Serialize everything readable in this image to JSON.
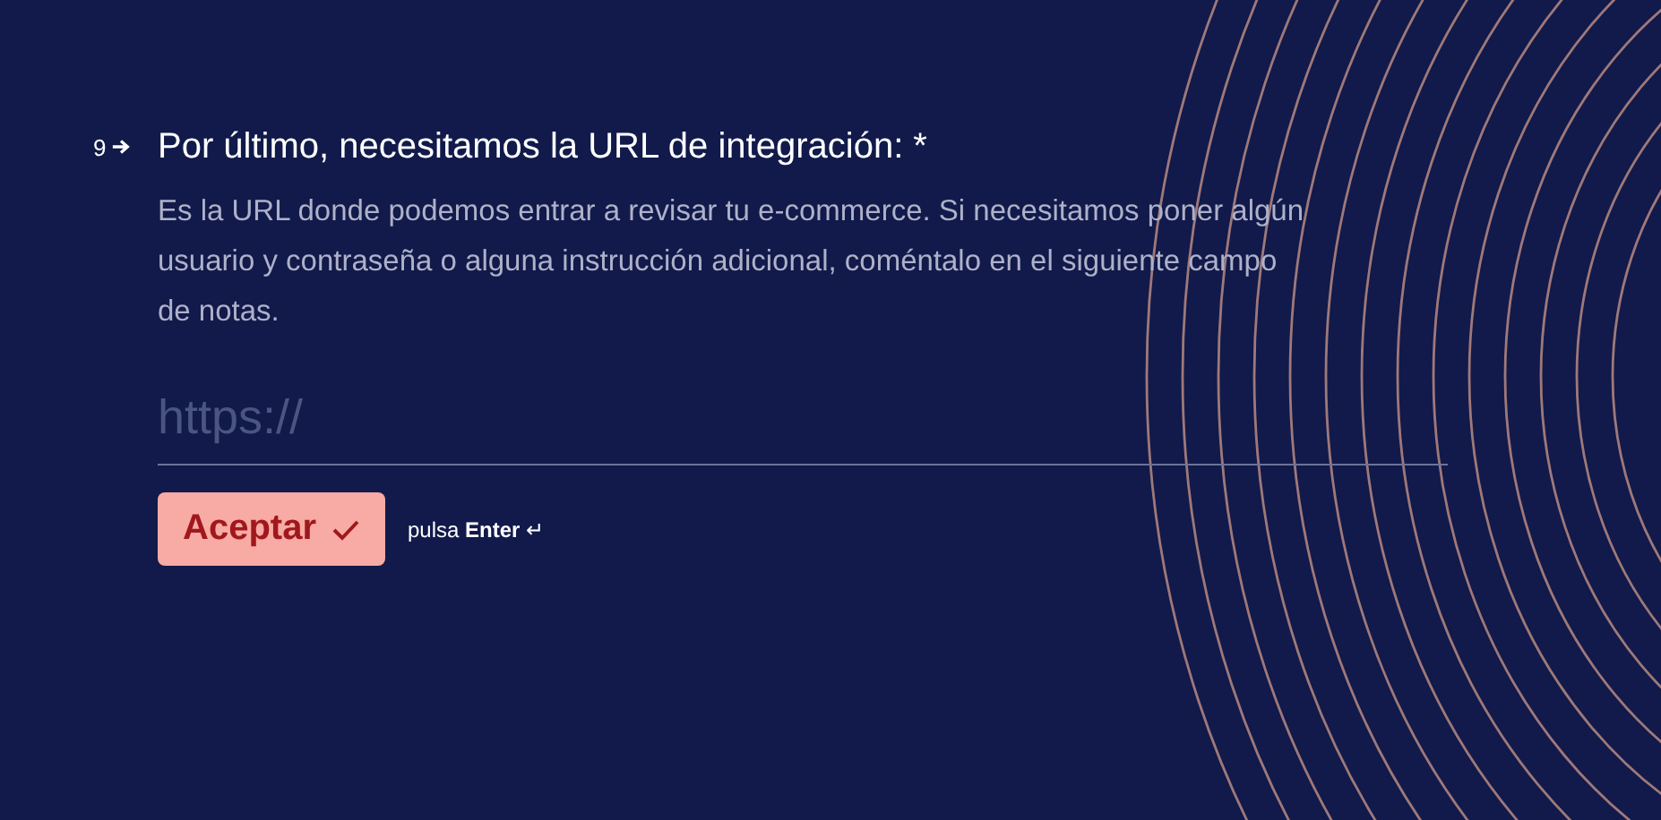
{
  "question": {
    "number": "9",
    "title": "Por último, necesitamos la URL de integración: *",
    "description": "Es la URL donde podemos entrar a revisar tu e-commerce. Si necesitamos poner algún usuario y contraseña o alguna instrucción adicional, coméntalo en el siguiente campo de notas."
  },
  "field": {
    "placeholder": "https://"
  },
  "submit": {
    "label": "Aceptar",
    "hint": "pulsa **Enter** ↵"
  }
}
